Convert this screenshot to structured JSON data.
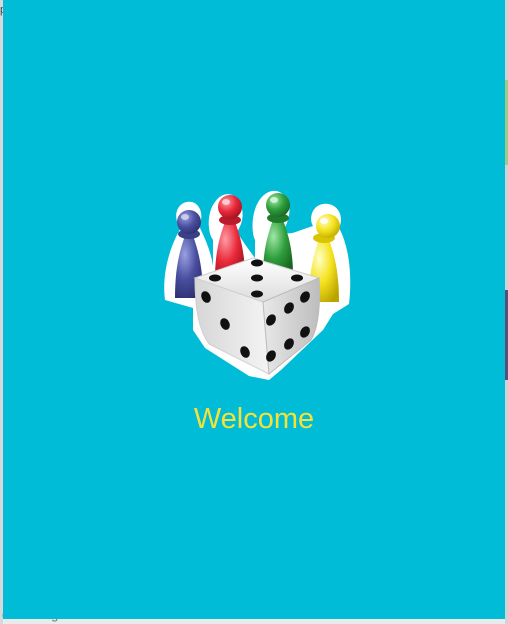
{
  "background": {
    "corner_glyph": "p",
    "bottom_text": "e message"
  },
  "splash": {
    "logo_icon": "dice-and-pawns-icon",
    "welcome_text": "Welcome"
  },
  "colors": {
    "background": "#00bcd6",
    "welcome_text": "#f4e13a",
    "pawn_blue": "#4a4fa0",
    "pawn_red": "#e8283a",
    "pawn_green": "#2e9e3c",
    "pawn_yellow": "#f5e21e"
  }
}
